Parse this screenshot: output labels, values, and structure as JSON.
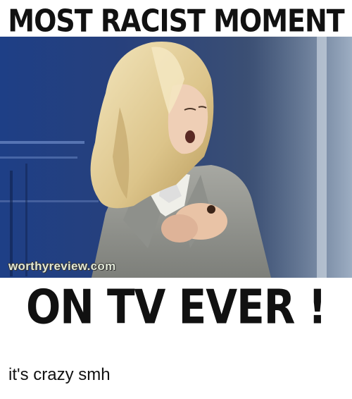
{
  "meme": {
    "top_caption": "MOST RACIST MOMENT",
    "bottom_caption": "ON TV EVER !",
    "watermark": "worthyreview.com",
    "image_subject": "photo-of-blonde-woman-in-grey-suit-on-tv-set"
  },
  "post": {
    "caption": "it's crazy smh"
  },
  "colors": {
    "background": "#ffffff",
    "caption_text": "#111111",
    "studio_blue": "#1d3f86",
    "suit_grey": "#9a9c98",
    "hair_blonde": "#e8d7a6"
  }
}
